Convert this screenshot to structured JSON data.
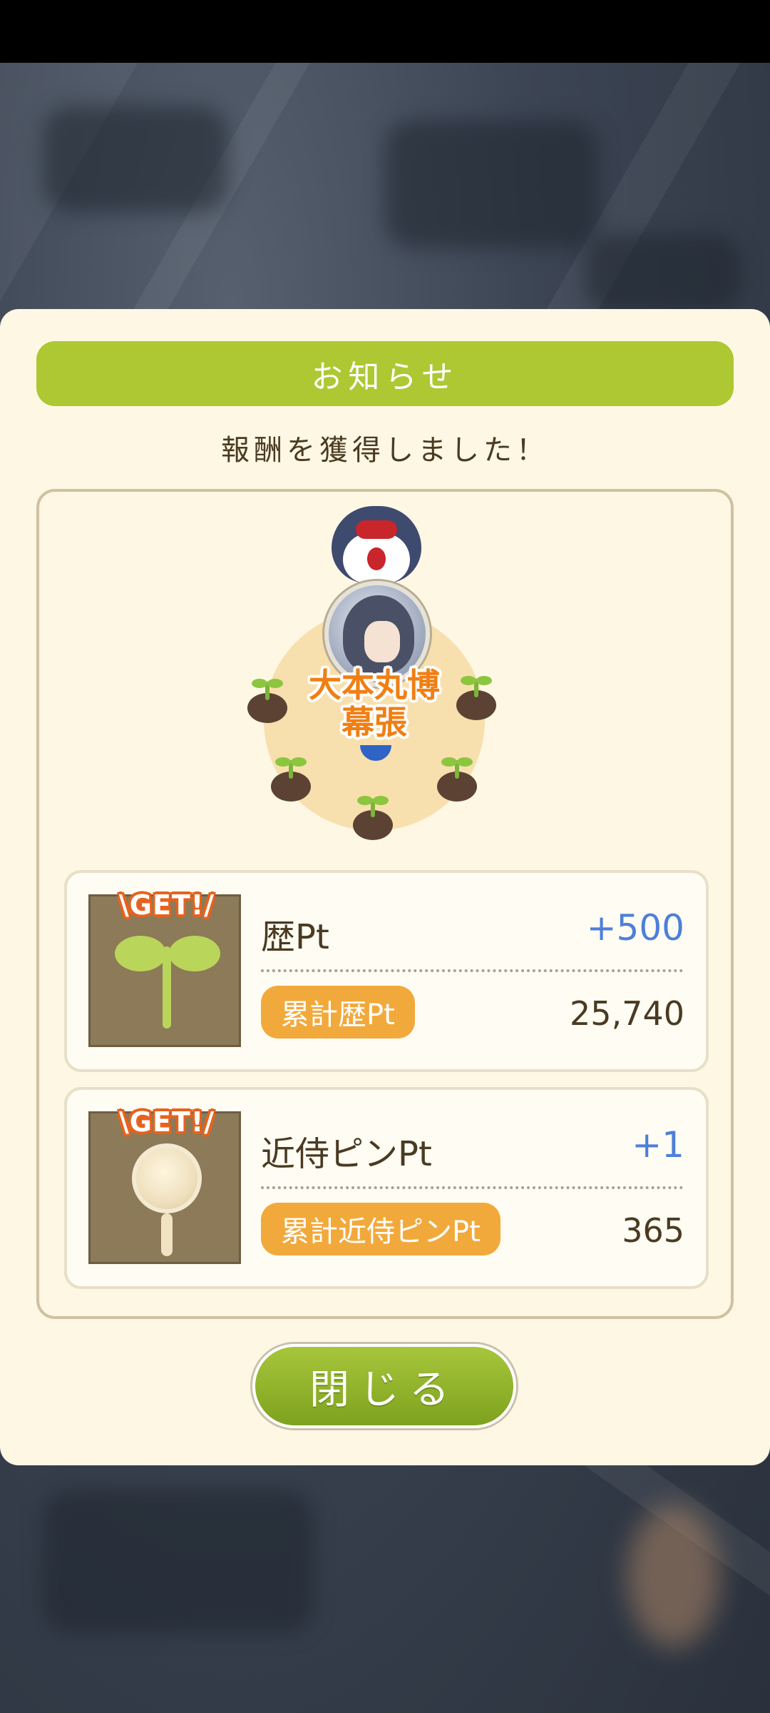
{
  "dialog": {
    "title": "お知らせ",
    "subtitle": "報酬を獲得しました！",
    "emblem": {
      "label_line1": "大本丸博",
      "label_line2": "幕張"
    },
    "rewards": [
      {
        "badge": "\\GET!/",
        "icon": "sprout-icon",
        "name": "歴Pt",
        "gain": "+500",
        "total_label": "累計歴Pt",
        "total_value": "25,740"
      },
      {
        "badge": "\\GET!/",
        "icon": "pin-icon",
        "name": "近侍ピンPt",
        "gain": "+1",
        "total_label": "累計近侍ピンPt",
        "total_value": "365"
      }
    ],
    "close_label": "閉じる"
  },
  "colors": {
    "title_bar": "#adc832",
    "dialog_bg": "#fdf7e3",
    "gain_text": "#4e7fd9",
    "pill": "#f2a93b",
    "emblem_text": "#f07f14"
  }
}
